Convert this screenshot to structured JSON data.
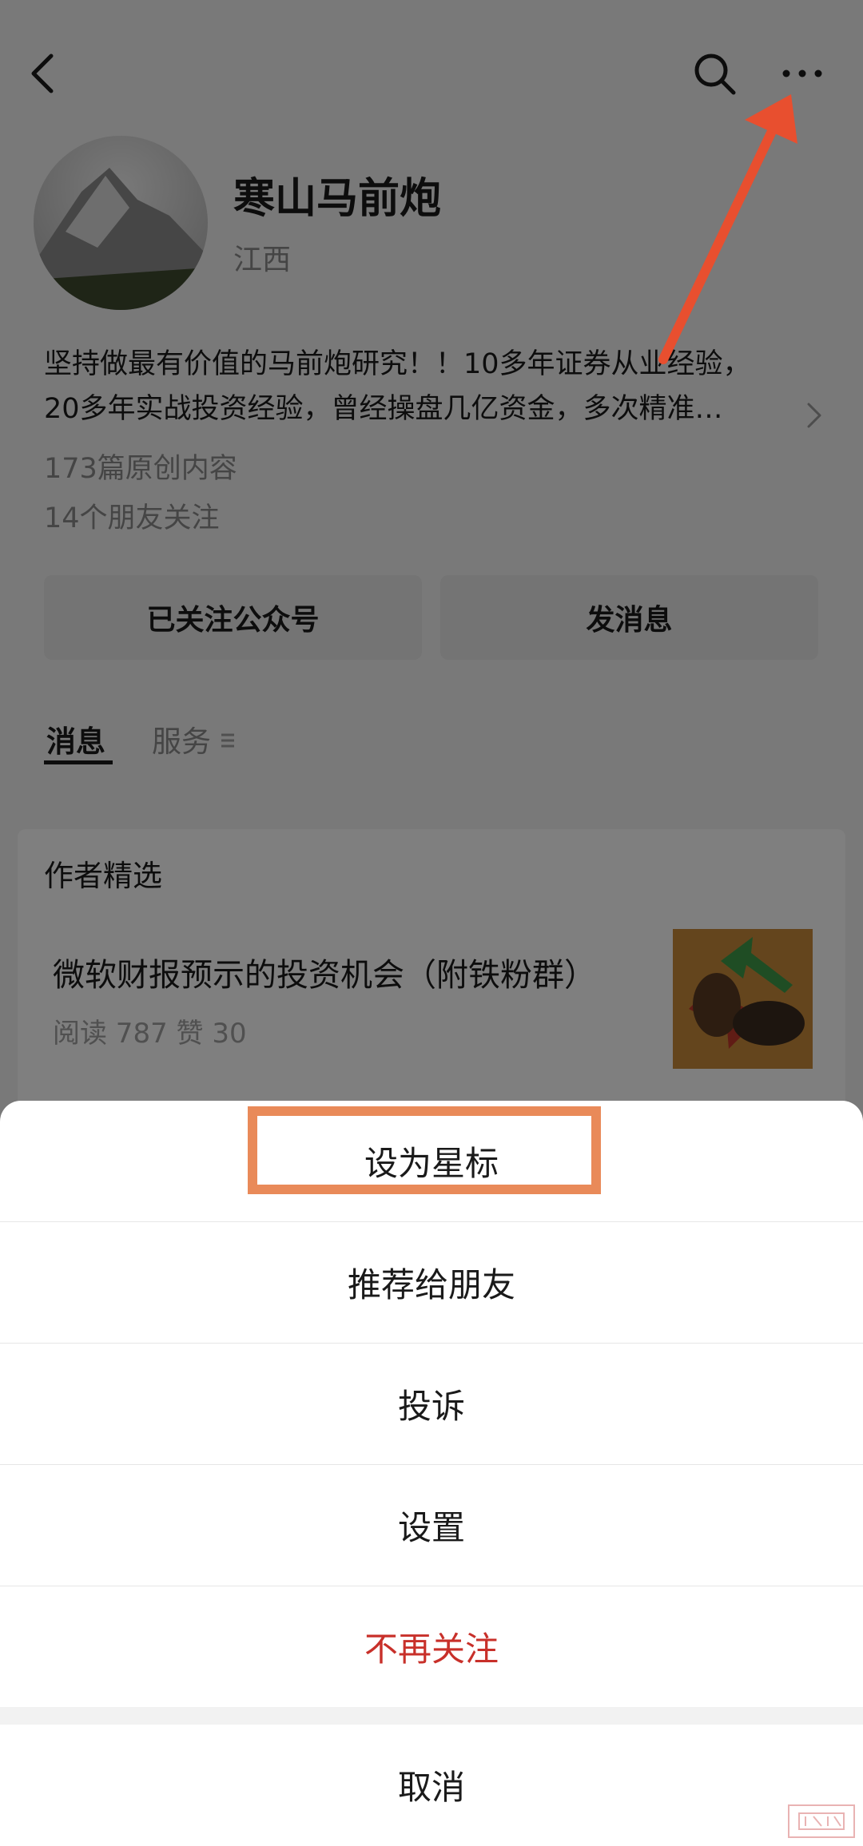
{
  "header": {
    "back_icon": "chevron-left-icon",
    "search_icon": "search-icon",
    "more_icon": "more-icon"
  },
  "profile": {
    "name": "寒山马前炮",
    "region": "江西",
    "bio_line1": "坚持做最有价值的马前炮研究！！10多年证券从业经验，",
    "bio_line2": "20多年实战投资经验，曾经操盘几亿资金，多次精准…",
    "original_count": "173篇原创内容",
    "friends_follow": "14个朋友关注"
  },
  "actions": {
    "follow_label": "已关注公众号",
    "message_label": "发消息"
  },
  "tabs": [
    {
      "label": "消息"
    },
    {
      "label": "服务"
    }
  ],
  "featured": {
    "title": "作者精选",
    "article_title": "微软财报预示的投资机会（附铁粉群）",
    "article_meta": "阅读 787   赞 30"
  },
  "sheet": {
    "items": [
      {
        "label": "设为星标"
      },
      {
        "label": "推荐给朋友"
      },
      {
        "label": "投诉"
      },
      {
        "label": "设置"
      },
      {
        "label": "不再关注"
      }
    ],
    "cancel_label": "取消"
  },
  "colors": {
    "danger": "#c8302a",
    "highlight": "#e98a59",
    "arrow": "#e84f2f"
  }
}
